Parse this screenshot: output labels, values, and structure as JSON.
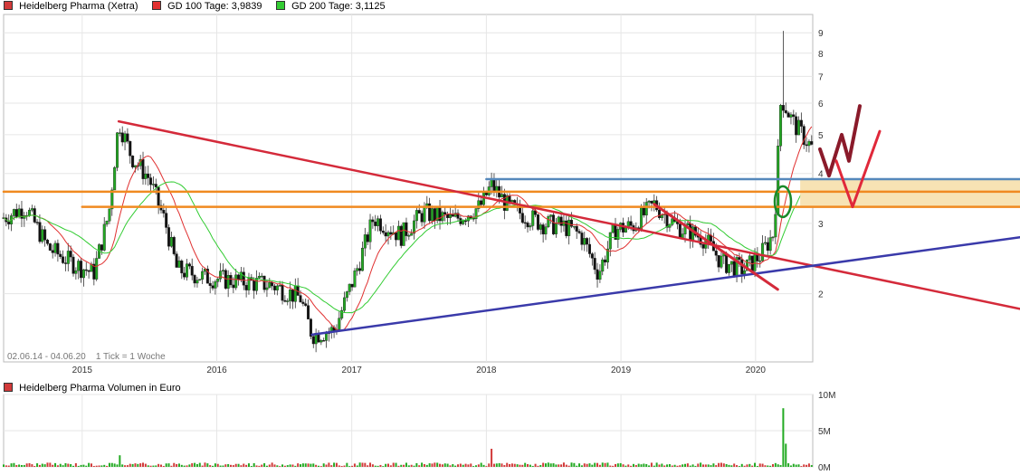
{
  "legend": [
    {
      "label": "Heidelberg Pharma (Xetra)",
      "color": "#d23a3a"
    },
    {
      "label": "GD 100 Tage: 3,9839",
      "color": "#e03030"
    },
    {
      "label": "GD 200 Tage: 3,1125",
      "color": "#33cc33"
    }
  ],
  "info_text": "02.06.14 - 04.06.20    1 Tick = 1 Woche",
  "volume_legend": {
    "label": "Heidelberg Pharma Volumen in Euro",
    "color": "#d23a3a"
  },
  "colors": {
    "up": "#22aa22",
    "down": "#111111",
    "ma100": "#e03030",
    "ma200": "#33cc33",
    "trend_red": "#d42a3a",
    "trend_blue": "#3a3aaa",
    "hline_orange": "#f08a20",
    "hline_blue": "#5588bb",
    "zone_fill": "#f7e3b4",
    "grid": "#e6e6e6"
  },
  "chart_data": [
    {
      "type": "candlestick",
      "title": "",
      "y_scale": "log",
      "y_ticks": [
        2,
        3,
        4,
        5,
        6,
        7,
        8,
        9
      ],
      "y_tick_labels": [
        "2",
        "3",
        "4",
        "5",
        "6",
        "7",
        "8",
        "9"
      ],
      "ylim": [
        1.35,
        10
      ],
      "x_range": [
        "2014-06-02",
        "2020-06-04"
      ],
      "x_ticks": [
        "2015",
        "2016",
        "2017",
        "2018",
        "2019",
        "2020"
      ],
      "price_path": [
        [
          "2014-06-02",
          3.1
        ],
        [
          "2014-08-01",
          3.3
        ],
        [
          "2014-10-01",
          2.6
        ],
        [
          "2014-12-01",
          2.4
        ],
        [
          "2015-02-01",
          2.25
        ],
        [
          "2015-03-15",
          3.2
        ],
        [
          "2015-04-10",
          5.4
        ],
        [
          "2015-05-15",
          4.4
        ],
        [
          "2015-07-01",
          3.9
        ],
        [
          "2015-08-15",
          3.0
        ],
        [
          "2015-09-15",
          2.3
        ],
        [
          "2015-12-01",
          2.2
        ],
        [
          "2016-03-01",
          2.15
        ],
        [
          "2016-06-01",
          2.1
        ],
        [
          "2016-08-15",
          1.95
        ],
        [
          "2016-09-15",
          1.58
        ],
        [
          "2016-11-15",
          1.62
        ],
        [
          "2017-01-15",
          2.3
        ],
        [
          "2017-03-01",
          3.1
        ],
        [
          "2017-05-15",
          2.8
        ],
        [
          "2017-07-15",
          3.2
        ],
        [
          "2017-10-01",
          3.05
        ],
        [
          "2017-12-15",
          3.3
        ],
        [
          "2018-01-15",
          3.75
        ],
        [
          "2018-03-01",
          3.3
        ],
        [
          "2018-06-01",
          3.0
        ],
        [
          "2018-08-01",
          2.95
        ],
        [
          "2018-09-15",
          2.8
        ],
        [
          "2018-11-01",
          2.25
        ],
        [
          "2018-12-15",
          2.9
        ],
        [
          "2019-02-01",
          2.95
        ],
        [
          "2019-04-01",
          3.35
        ],
        [
          "2019-06-01",
          2.95
        ],
        [
          "2019-08-15",
          2.75
        ],
        [
          "2019-10-01",
          2.4
        ],
        [
          "2019-12-01",
          2.3
        ],
        [
          "2020-01-15",
          2.5
        ],
        [
          "2020-02-20",
          2.85
        ],
        [
          "2020-03-10",
          6.2
        ],
        [
          "2020-04-10",
          5.4
        ],
        [
          "2020-06-04",
          4.6
        ]
      ],
      "peak": {
        "date": "2020-03-15",
        "value": 9.1
      },
      "lines": {
        "red_trend_main": [
          [
            "2015-04-10",
            5.4
          ],
          [
            "2020-06-04",
            2.35
          ]
        ],
        "red_trend_short": [
          [
            "2019-04-01",
            3.35
          ],
          [
            "2020-03-01",
            2.05
          ]
        ],
        "blue_support": [
          [
            "2016-09-15",
            1.58
          ],
          [
            "2020-06-04",
            2.35
          ]
        ],
        "blue_horizontal": [
          [
            "2018-01-01",
            3.87
          ],
          [
            "2020-06-04",
            3.87
          ]
        ],
        "orange_upper": [
          [
            "2014-06-02",
            3.6
          ],
          [
            "2020-06-04",
            3.6
          ]
        ],
        "orange_lower": [
          [
            "2015-01-01",
            3.3
          ],
          [
            "2020-06-04",
            3.3
          ]
        ]
      },
      "ellipse_annotation": {
        "date": "2020-03-15",
        "value": 3.4
      }
    },
    {
      "type": "bar",
      "title": "",
      "y_ticks": [
        0,
        5,
        10
      ],
      "y_tick_labels": [
        "0M",
        "5M",
        "10M"
      ],
      "ylim": [
        0,
        10
      ],
      "unit": "M",
      "spikes": [
        [
          "2015-04-10",
          1.6
        ],
        [
          "2018-01-15",
          2.5
        ],
        [
          "2020-03-15",
          8.1
        ],
        [
          "2020-03-25",
          3.2
        ]
      ],
      "base_volume": 0.35
    }
  ]
}
